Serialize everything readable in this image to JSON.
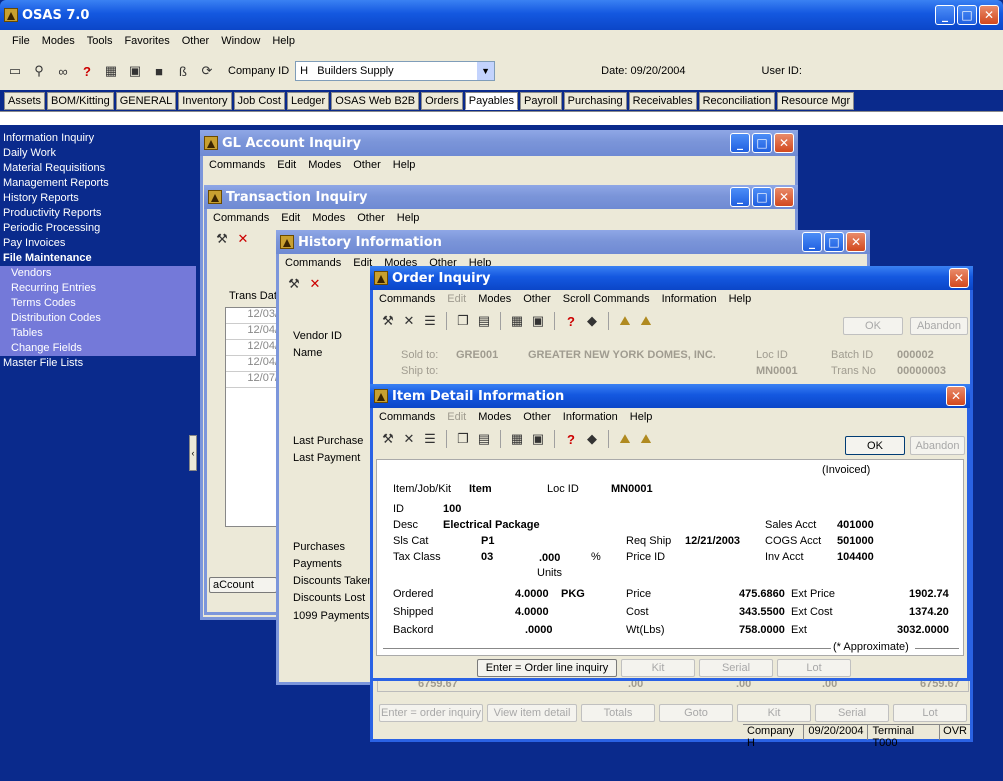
{
  "app": {
    "title": "OSAS 7.0"
  },
  "menu": [
    "File",
    "Modes",
    "Tools",
    "Favorites",
    "Other",
    "Window",
    "Help"
  ],
  "toolbar": {
    "company_label": "Company ID",
    "company_value": "H   Builders Supply",
    "date": "Date: 09/20/2004",
    "user": "User ID:"
  },
  "tabs": [
    "Assets",
    "BOM/Kitting",
    "GENERAL",
    "Inventory",
    "Job Cost",
    "Ledger",
    "OSAS Web B2B",
    "Orders",
    "Payables",
    "Payroll",
    "Purchasing",
    "Receivables",
    "Reconciliation",
    "Resource Mgr"
  ],
  "active_tab": "Payables",
  "nav": {
    "items": [
      "Information Inquiry",
      "Daily Work",
      "Material Requisitions",
      "Management Reports",
      "History Reports",
      "Productivity Reports",
      "Periodic Processing",
      "Pay Invoices"
    ],
    "section": "File Maintenance",
    "sub": [
      "Vendors",
      "Recurring Entries",
      "Terms Codes",
      "Distribution Codes",
      "Tables",
      "Change Fields"
    ],
    "after": "Master File Lists"
  },
  "gl": {
    "title": "GL Account Inquiry",
    "menu": [
      "Commands",
      "Edit",
      "Modes",
      "Other",
      "Help"
    ]
  },
  "trans": {
    "title": "Transaction Inquiry",
    "menu": [
      "Commands",
      "Edit",
      "Modes",
      "Other",
      "Help"
    ],
    "trans_dat": "Trans Dat",
    "dates": [
      "12/03/",
      "12/04/",
      "12/04/",
      "12/04/",
      "12/07/"
    ],
    "account": "aCcount"
  },
  "hist": {
    "title": "History Information",
    "menu": [
      "Commands",
      "Edit",
      "Modes",
      "Other",
      "Help"
    ],
    "vendor_id": "Vendor ID",
    "name": "Name",
    "last_purchase": "Last Purchase",
    "last_payment": "Last Payment",
    "purchases": "Purchases",
    "payments": "Payments",
    "disc_taken": "Discounts Taken",
    "disc_lost": "Discounts Lost",
    "p1099": "1099 Payments"
  },
  "order": {
    "title": "Order Inquiry",
    "menu": [
      "Commands",
      "Edit",
      "Modes",
      "Other",
      "Scroll Commands",
      "Information",
      "Help"
    ],
    "ok": "OK",
    "abandon": "Abandon",
    "sold_to": "Sold to:",
    "sold_code": "GRE001",
    "sold_name": "GREATER NEW YORK DOMES, INC.",
    "ship_to": "Ship to:",
    "loc_id": "Loc ID",
    "loc_val": "MN0001",
    "batch_id": "Batch ID",
    "batch_val": "000002",
    "trans_no": "Trans No",
    "trans_val": "00000003",
    "totals": [
      "6759.67",
      ".00",
      ".00",
      ".00",
      "6759.67"
    ],
    "buttons": [
      "Enter = order inquiry",
      "View item detail",
      "Totals",
      "Goto",
      "Kit",
      "Serial",
      "Lot"
    ],
    "status": [
      "Company H",
      "09/20/2004",
      "Terminal T000",
      "OVR"
    ]
  },
  "item": {
    "title": "Item Detail Information",
    "menu": [
      "Commands",
      "Edit",
      "Modes",
      "Other",
      "Information",
      "Help"
    ],
    "ok": "OK",
    "abandon": "Abandon",
    "invoiced": "(Invoiced)",
    "itemjobkit": "Item/Job/Kit",
    "item_type": "Item",
    "loc_id": "Loc ID",
    "loc_val": "MN0001",
    "id_label": "ID",
    "id_val": "100",
    "desc_label": "Desc",
    "desc_val": "Electrical Package",
    "slscat_label": "Sls Cat",
    "slscat_val": "P1",
    "taxclass_label": "Tax Class",
    "taxclass_val": "03",
    "tax_pct": ".000",
    "pct": "%",
    "units": "Units",
    "reqship_label": "Req Ship",
    "reqship_val": "12/21/2003",
    "priceid_label": "Price ID",
    "salesacct_label": "Sales Acct",
    "salesacct_val": "401000",
    "cogsacct_label": "COGS Acct",
    "cogsacct_val": "501000",
    "invacct_label": "Inv Acct",
    "invacct_val": "104400",
    "ordered_label": "Ordered",
    "ordered_val": "4.0000",
    "uom": "PKG",
    "shipped_label": "Shipped",
    "shipped_val": "4.0000",
    "backord_label": "Backord",
    "backord_val": ".0000",
    "price_label": "Price",
    "price_val": "475.6860",
    "extprice_label": "Ext Price",
    "extprice_val": "1902.74",
    "cost_label": "Cost",
    "cost_val": "343.5500",
    "extcost_label": "Ext Cost",
    "extcost_val": "1374.20",
    "wt_label": "Wt(Lbs)",
    "wt_val": "758.0000",
    "ext_label": "Ext",
    "ext_val": "3032.0000",
    "approx": "(* Approximate)",
    "buttons": [
      "Enter = Order line inquiry",
      "Kit",
      "Serial",
      "Lot"
    ]
  }
}
